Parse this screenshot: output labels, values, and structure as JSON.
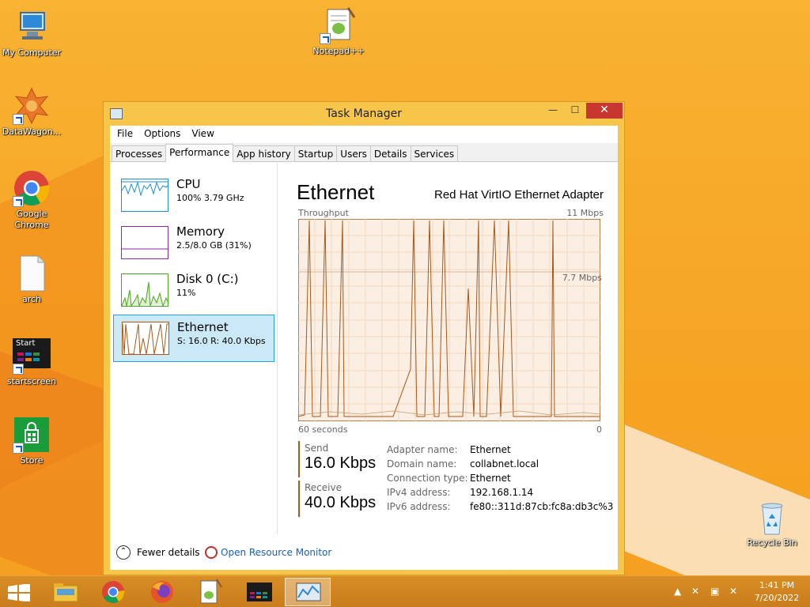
{
  "desktop": {
    "icons": [
      {
        "label": "My Computer",
        "icon": "computer-icon"
      },
      {
        "label": "DataWagon...",
        "icon": "datawagon-icon"
      },
      {
        "label": "Google Chrome",
        "icon": "chrome-icon"
      },
      {
        "label": "arch",
        "icon": "file-icon"
      },
      {
        "label": "startscreen",
        "icon": "startscreen-icon"
      },
      {
        "label": "Store",
        "icon": "store-icon"
      },
      {
        "label": "Notepad++",
        "icon": "notepadpp-icon"
      },
      {
        "label": "Recycle Bin",
        "icon": "recycle-bin-icon"
      }
    ],
    "startscreen_badge": "Start"
  },
  "window": {
    "title": "Task Manager",
    "controls": {
      "minimize": "—",
      "maximize": "☐",
      "close": "✕"
    },
    "menu": [
      "File",
      "Options",
      "View"
    ],
    "tabs": [
      "Processes",
      "Performance",
      "App history",
      "Startup",
      "Users",
      "Details",
      "Services"
    ],
    "active_tab": "Performance"
  },
  "sidebar": {
    "items": [
      {
        "name": "CPU",
        "value": "100%  3.79 GHz",
        "color": "#1b8fd0"
      },
      {
        "name": "Memory",
        "value": "2.5/8.0 GB (31%)",
        "color": "#8b2aa3"
      },
      {
        "name": "Disk 0 (C:)",
        "value": "11%",
        "color": "#4da420"
      },
      {
        "name": "Ethernet",
        "value": "S: 16.0  R: 40.0 Kbps",
        "color": "#a7591a"
      }
    ],
    "selected": "Ethernet"
  },
  "main": {
    "title": "Ethernet",
    "adapter": "Red Hat VirtIO Ethernet Adapter",
    "graph_label": "Throughput",
    "graph_max": "11 Mbps",
    "graph_mid": "7.7 Mbps",
    "graph_xleft": "60 seconds",
    "graph_xright": "0",
    "send_label": "Send",
    "send_value": "16.0 Kbps",
    "receive_label": "Receive",
    "receive_value": "40.0 Kbps",
    "properties": [
      {
        "key": "Adapter name:",
        "value": "Ethernet"
      },
      {
        "key": "Domain name:",
        "value": "collabnet.local"
      },
      {
        "key": "Connection type:",
        "value": "Ethernet"
      },
      {
        "key": "IPv4 address:",
        "value": "192.168.1.14"
      },
      {
        "key": "IPv6 address:",
        "value": "fe80::311d:87cb:fc8a:db3c%3"
      }
    ],
    "colors": {
      "line": "#a7591a",
      "fill": "#fbeee2",
      "grid": "#f0d8c0"
    }
  },
  "footer": {
    "fewer_details": "Fewer details",
    "open_resource_monitor": "Open Resource Monitor"
  },
  "taskbar": {
    "apps": [
      "start-icon",
      "file-explorer-icon",
      "chrome-icon",
      "firefox-icon",
      "notepadpp-icon",
      "startscreen-icon",
      "task-manager-icon"
    ],
    "time": "1:41 PM",
    "date": "7/20/2022"
  }
}
